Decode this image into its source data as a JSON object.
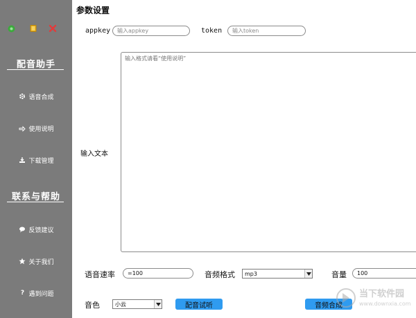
{
  "sidebar": {
    "section1_title": "配音助手",
    "section2_title": "联系与帮助",
    "items": [
      {
        "label": "语音合成",
        "icon": "gear-icon"
      },
      {
        "label": "使用说明",
        "icon": "hand-pointer-icon"
      },
      {
        "label": "下载管理",
        "icon": "download-icon"
      },
      {
        "label": "反馈建议",
        "icon": "chat-bubble-icon"
      },
      {
        "label": "关于我们",
        "icon": "star-icon"
      },
      {
        "label": "遇到问题",
        "icon": "question-icon"
      }
    ]
  },
  "main": {
    "heading": "参数设置",
    "appkey_label": "appkey",
    "appkey_placeholder": "输入appkey",
    "token_label": "token",
    "token_placeholder": "输入token",
    "input_label": "输入文本",
    "input_placeholder": "输入格式请看“使用说明”",
    "speed_label": "语音速率",
    "speed_value": "=100",
    "format_label": "音频格式",
    "format_value": "mp3",
    "volume_label": "音量",
    "volume_value": "100",
    "voice_label": "音色",
    "voice_value": "小云",
    "preview_button": "配音试听",
    "synth_button": "音频合成"
  },
  "watermark": {
    "text": "当下软件园",
    "url": "www.downxia.com"
  },
  "colors": {
    "sidebar": "#7b7b7b",
    "button": "#2f9bf0",
    "minimize": "#3caa3c",
    "maximize": "#e8b020",
    "close": "#e03c3c"
  }
}
